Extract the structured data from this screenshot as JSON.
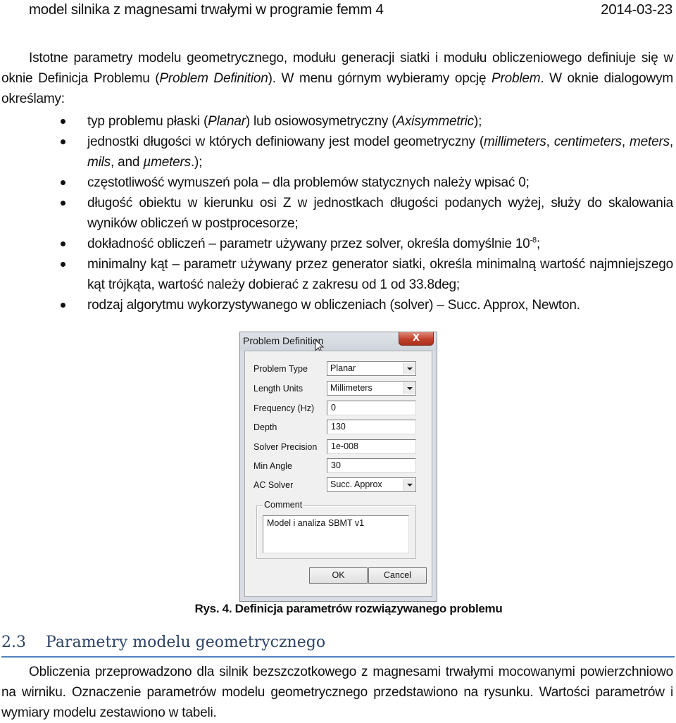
{
  "header": {
    "title": "model silnika z magnesami trwałymi w programie femm 4",
    "date": "2014-03-23"
  },
  "intro": {
    "part1": "Istotne parametry modelu geometrycznego, modułu generacji siatki i modułu obliczeniowego definiuje się w oknie Definicja Problemu (",
    "part1_italic": "Problem Definition",
    "part2": "). W menu górnym wybieramy opcję ",
    "part2_italic": "Problem",
    "part3": ". W oknie dialogowym określamy:"
  },
  "bullets": [
    {
      "a": "typ problemu płaski (",
      "b_i": "Planar",
      "c": ") lub osiowosymetryczny (",
      "d_i": "Axisymmetric",
      "e": ");"
    },
    {
      "a": "jednostki długości w których definiowany jest model geometryczny (",
      "b_i": "millimeters",
      "c": ", ",
      "d_i": "centimeters",
      "e": ", ",
      "f_i": "meters",
      "g": ", ",
      "h_i": "mils",
      "i": ", and ",
      "j_i": "µmeters",
      "k": ".);"
    },
    {
      "text": " częstotliwość wymuszeń pola – dla problemów statycznych należy wpisać 0;"
    },
    {
      "text": "długość obiektu w kierunku osi Z w jednostkach długości podanych wyżej, służy do skalowania wyników obliczeń w postprocesorze;"
    },
    {
      "text": "dokładność obliczeń – parametr używany przez solver, określa domyślnie 10",
      "sup": "-8",
      "tail": ";"
    },
    {
      "text": "minimalny kąt – parametr używany przez generator siatki, określa minimalną wartość najmniejszego kąt trójkąta, wartość należy dobierać z zakresu od 1 od 33.8deg;"
    },
    {
      "text": "rodzaj algorytmu wykorzystywanego w obliczeniach (solver) – Succ. Approx, Newton."
    }
  ],
  "dialog": {
    "title": "Problem Definition",
    "close_label": "X",
    "fields": [
      {
        "label": "Problem Type",
        "value": "Planar",
        "kind": "combo"
      },
      {
        "label": "Length Units",
        "value": "Millimeters",
        "kind": "combo"
      },
      {
        "label": "Frequency (Hz)",
        "value": "0",
        "kind": "text"
      },
      {
        "label": "Depth",
        "value": "130",
        "kind": "text"
      },
      {
        "label": "Solver Precision",
        "value": "1e-008",
        "kind": "text"
      },
      {
        "label": "Min Angle",
        "value": "30",
        "kind": "text"
      },
      {
        "label": "AC Solver",
        "value": "Succ. Approx",
        "kind": "combo"
      }
    ],
    "comment_label": "Comment",
    "comment_value": "Model i analiza SBMT v1",
    "ok_label": "OK",
    "cancel_label": "Cancel"
  },
  "figure_caption": "Rys. 4. Definicja parametrów rozwiązywanego problemu",
  "section": {
    "number": "2.3",
    "title": "Parametry modelu geometrycznego"
  },
  "body_paragraph": "Obliczenia przeprowadzono dla silnik bezszczotkowego z magnesami trwałymi mocowanymi powierzchniowo na wirniku. Oznaczenie parametrów modelu geometrycznego przedstawiono na rysunku. Wartości parametrów i wymiary modelu zestawiono w tabeli.",
  "colors": {
    "heading": "#2d4466",
    "heading_rule": "#4f81bd",
    "close_button": "#c1402a"
  }
}
